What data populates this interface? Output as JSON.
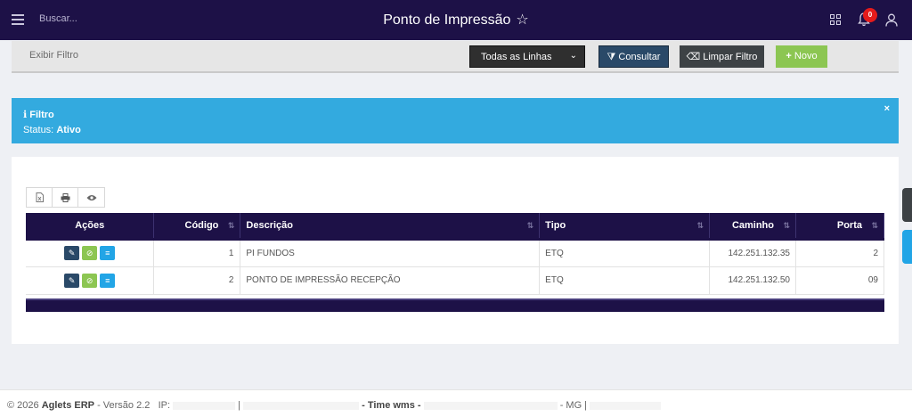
{
  "header": {
    "search_placeholder": "Buscar...",
    "title": "Ponto de Impressão",
    "star_icon": "☆",
    "notification_count": "0"
  },
  "filterbar": {
    "exibir_filtro": "Exibir Filtro",
    "line_select_value": "Todas as Linhas",
    "consultar_label": "Consultar",
    "limpar_label": "Limpar Filtro",
    "novo_label": "Novo"
  },
  "alert": {
    "title": "Filtro",
    "status_label": "Status:",
    "status_value": "Ativo",
    "close": "×"
  },
  "table": {
    "headers": {
      "acoes": "Ações",
      "codigo": "Código",
      "descricao": "Descrição",
      "tipo": "Tipo",
      "caminho": "Caminho",
      "porta": "Porta"
    },
    "rows": [
      {
        "codigo": "1",
        "descricao": "PI FUNDOS",
        "tipo": "ETQ",
        "caminho": "142.251.132.35",
        "porta": "2"
      },
      {
        "codigo": "2",
        "descricao": "PONTO DE IMPRESSÃO RECEPÇÃO",
        "tipo": "ETQ",
        "caminho": "142.251.132.50",
        "porta": "09"
      }
    ]
  },
  "footer": {
    "copyright": "© 2026",
    "app_name": "Aglets ERP",
    "version": "- Versão 2.2",
    "ip_label": "IP:",
    "sep1": "|",
    "time_label": "- Time wms -",
    "state": "- MG |"
  },
  "colors": {
    "header_bg": "#1d1147",
    "alert_bg": "#33aadf",
    "consultar_bg": "#2a4968",
    "limpar_bg": "#3d4245",
    "novo_bg": "#8cc652"
  }
}
